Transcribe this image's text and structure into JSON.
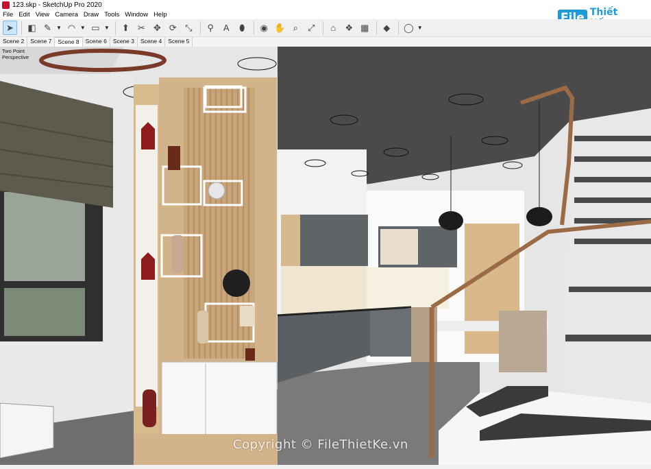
{
  "window": {
    "title": "123.skp - SketchUp Pro 2020"
  },
  "menu": [
    "File",
    "Edit",
    "View",
    "Camera",
    "Draw",
    "Tools",
    "Window",
    "Help"
  ],
  "toolbar": {
    "tools": [
      {
        "name": "select-tool-icon",
        "glyph": "➤"
      },
      {
        "name": "eraser-tool-icon",
        "glyph": "◧"
      },
      {
        "name": "pencil-tool-icon",
        "glyph": "✎"
      },
      {
        "name": "arc-tool-icon",
        "glyph": "◠"
      },
      {
        "name": "shape-tool-icon",
        "glyph": "▭"
      },
      {
        "name": "push-pull-tool-icon",
        "glyph": "⬆"
      },
      {
        "name": "offset-tool-icon",
        "glyph": "✂"
      },
      {
        "name": "move-tool-icon",
        "glyph": "✥"
      },
      {
        "name": "rotate-tool-icon",
        "glyph": "⟳"
      },
      {
        "name": "scale-tool-icon",
        "glyph": "⤡"
      },
      {
        "name": "tape-measure-icon",
        "glyph": "⚲"
      },
      {
        "name": "text-tool-icon",
        "glyph": "A"
      },
      {
        "name": "paint-bucket-icon",
        "glyph": "⬮"
      },
      {
        "name": "orbit-tool-icon",
        "glyph": "◉"
      },
      {
        "name": "pan-tool-icon",
        "glyph": "✋"
      },
      {
        "name": "zoom-tool-icon",
        "glyph": "⌕"
      },
      {
        "name": "zoom-extents-icon",
        "glyph": "⤢"
      },
      {
        "name": "warehouse-icon",
        "glyph": "⌂"
      },
      {
        "name": "extension-warehouse-icon",
        "glyph": "❖"
      },
      {
        "name": "layout-icon",
        "glyph": "▦"
      },
      {
        "name": "ruby-icon",
        "glyph": "◆"
      },
      {
        "name": "account-icon",
        "glyph": "◯"
      }
    ]
  },
  "scenes": [
    "Scene 2",
    "Scene 7",
    "Scene 8",
    "Scene 6",
    "Scene 3",
    "Scene 4",
    "Scene 5"
  ],
  "active_scene": "Scene 8",
  "viewport": {
    "camera_label_1": "Two Point",
    "camera_label_2": "Perspective"
  },
  "logo": {
    "badge": "File",
    "text": "Thiết Kế.vn"
  },
  "watermark": "Copyright © FileThietKe.vn"
}
